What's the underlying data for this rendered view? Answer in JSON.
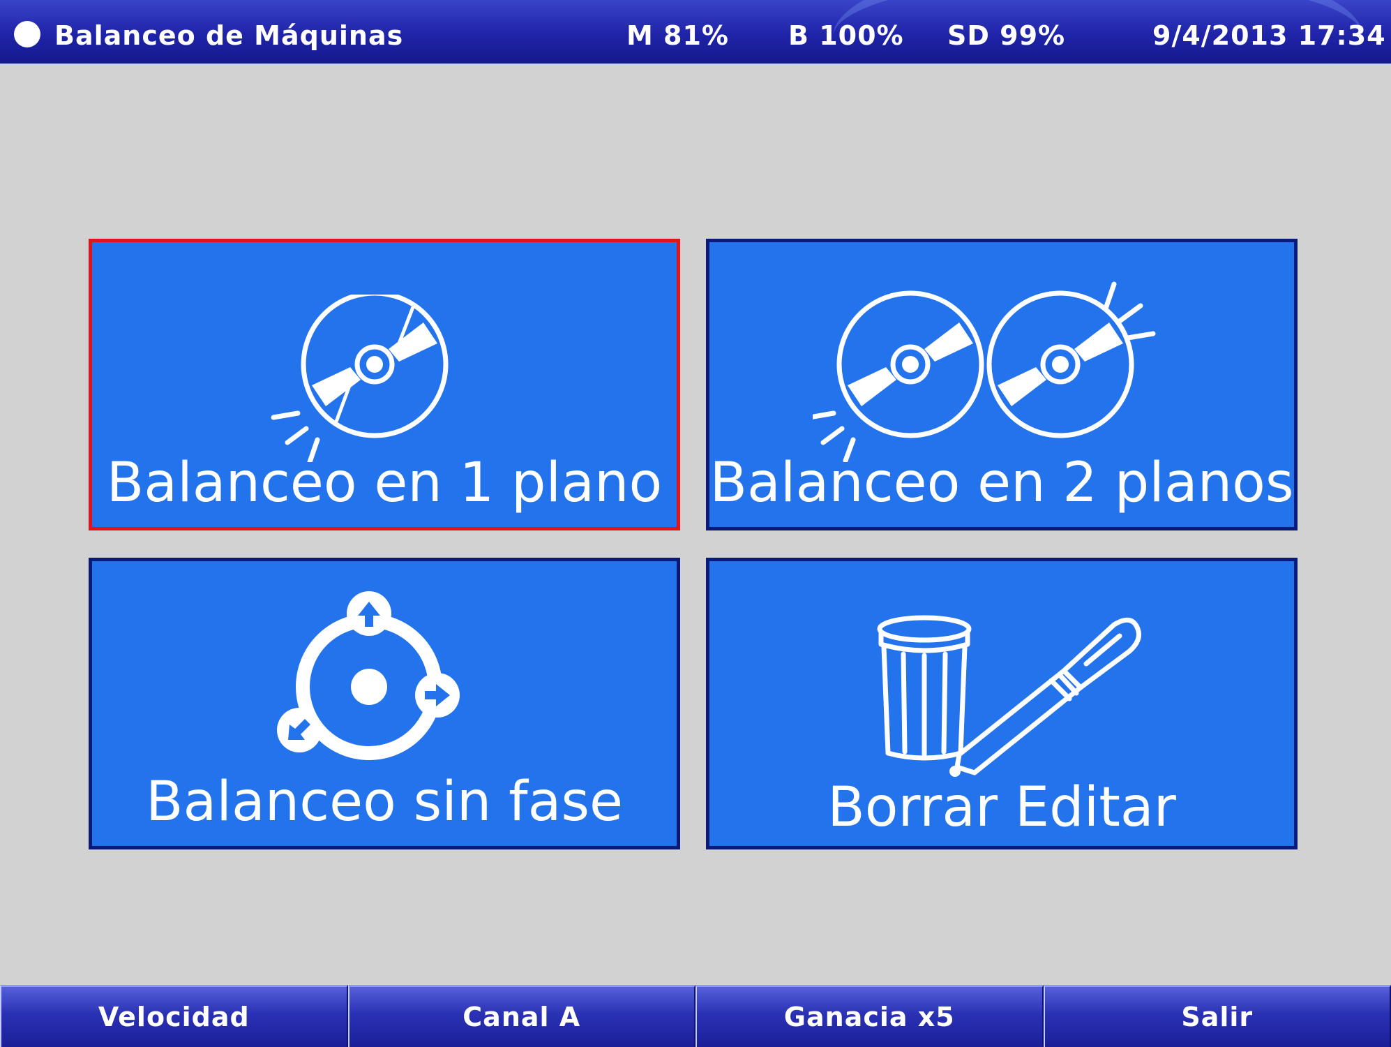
{
  "header": {
    "title": "Balanceo de Máquinas",
    "status_m": "M 81%",
    "status_b": "B 100%",
    "status_sd": "SD 99%",
    "datetime": "9/4/2013 17:34"
  },
  "tiles": [
    {
      "label": "Balanceo en 1 plano",
      "icon": "single-disc-icon",
      "selected": true
    },
    {
      "label": "Balanceo en 2 planos",
      "icon": "double-disc-icon",
      "selected": false
    },
    {
      "label": "Balanceo sin fase",
      "icon": "rotor-arrows-icon",
      "selected": false
    },
    {
      "label": "Borrar Editar",
      "icon": "trash-pen-icon",
      "selected": false
    }
  ],
  "footer": {
    "buttons": [
      "Velocidad",
      "Canal A",
      "Ganacia x5",
      "Salir"
    ]
  },
  "colors": {
    "background": "#d2d2d2",
    "tile": "#2373ec",
    "tile_border": "#0a1a78",
    "selected_border": "#e0151a",
    "header": "#1f23a8"
  }
}
